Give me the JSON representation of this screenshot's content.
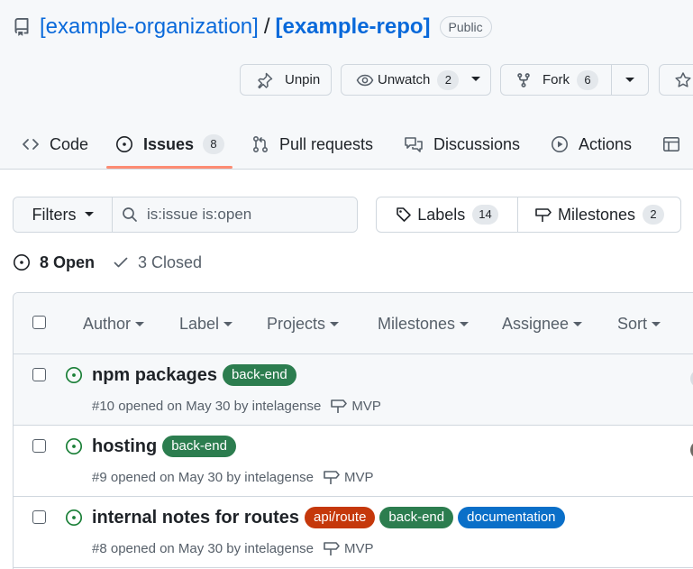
{
  "repo": {
    "owner": "[example-organization]",
    "separator": "/",
    "name": "[example-repo]",
    "visibility": "Public"
  },
  "actions": {
    "unpin": "Unpin",
    "unwatch": "Unwatch",
    "watch_count": "2",
    "fork": "Fork",
    "fork_count": "6"
  },
  "tabs": [
    {
      "label": "Code",
      "icon": "code-icon"
    },
    {
      "label": "Issues",
      "icon": "issue-opened-icon",
      "count": "8",
      "active": true
    },
    {
      "label": "Pull requests",
      "icon": "git-pull-request-icon"
    },
    {
      "label": "Discussions",
      "icon": "comment-discussion-icon"
    },
    {
      "label": "Actions",
      "icon": "play-icon"
    },
    {
      "label": "",
      "icon": "table-icon"
    }
  ],
  "filter": {
    "button_label": "Filters",
    "query": "is:issue is:open"
  },
  "labels_button": {
    "label": "Labels",
    "count": "14"
  },
  "milestones_button": {
    "label": "Milestones",
    "count": "2"
  },
  "states": {
    "open": "8 Open",
    "closed": "3 Closed"
  },
  "list_header": {
    "author": "Author",
    "label": "Label",
    "projects": "Projects",
    "milestones": "Milestones",
    "assignee": "Assignee",
    "sort": "Sort"
  },
  "issues": [
    {
      "title": "npm packages",
      "labels": [
        {
          "name": "back-end",
          "color": "#2c7d4f"
        }
      ],
      "meta": "#10 opened on May 30 by intelagense",
      "milestone": "MVP"
    },
    {
      "title": "hosting",
      "labels": [
        {
          "name": "back-end",
          "color": "#2c7d4f"
        }
      ],
      "meta": "#9 opened on May 30 by intelagense",
      "milestone": "MVP"
    },
    {
      "title": "internal notes for routes",
      "labels": [
        {
          "name": "api/route",
          "color": "#c5380b"
        },
        {
          "name": "back-end",
          "color": "#2c7d4f"
        },
        {
          "name": "documentation",
          "color": "#0a6fc8"
        }
      ],
      "meta": "#8 opened on May 30 by intelagense",
      "milestone": "MVP"
    }
  ],
  "colors": {
    "link": "#0969da",
    "open_green": "#1a7f37",
    "active_tab_underline": "#fd8c73",
    "border": "#d0d7de"
  }
}
